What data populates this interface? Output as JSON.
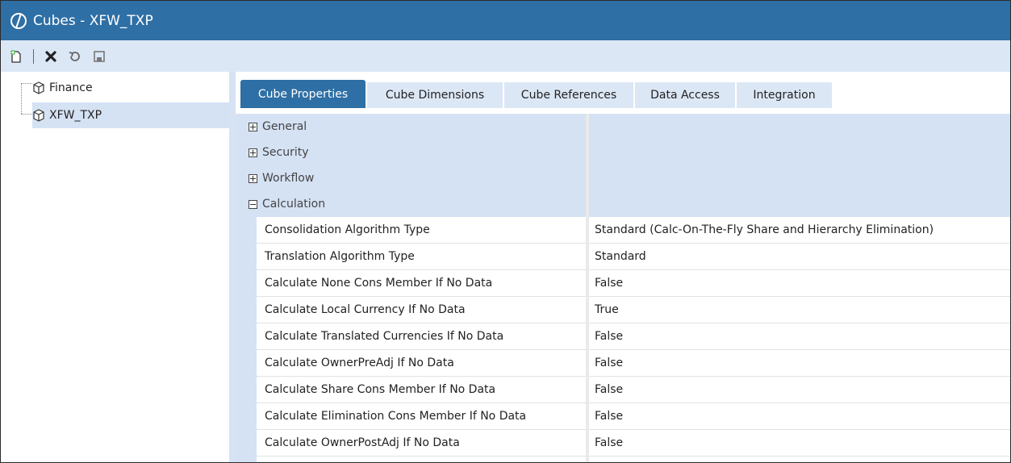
{
  "window": {
    "title": "Cubes - XFW_TXP"
  },
  "toolbar": {
    "buttons": [
      {
        "name": "new-icon"
      },
      {
        "name": "delete-icon"
      },
      {
        "name": "refresh-icon"
      },
      {
        "name": "save-icon"
      }
    ]
  },
  "tree": {
    "items": [
      {
        "label": "Finance",
        "icon": "cube-icon",
        "selected": false
      },
      {
        "label": "XFW_TXP",
        "icon": "cube-icon",
        "selected": true
      }
    ]
  },
  "tabs": [
    {
      "label": "Cube Properties",
      "active": true
    },
    {
      "label": "Cube Dimensions",
      "active": false
    },
    {
      "label": "Cube References",
      "active": false
    },
    {
      "label": "Data Access",
      "active": false
    },
    {
      "label": "Integration",
      "active": false
    }
  ],
  "categories": [
    {
      "label": "General",
      "expanded": false
    },
    {
      "label": "Security",
      "expanded": false
    },
    {
      "label": "Workflow",
      "expanded": false
    },
    {
      "label": "Calculation",
      "expanded": true
    }
  ],
  "properties": [
    {
      "name": "Consolidation Algorithm Type",
      "value": "Standard (Calc-On-The-Fly Share and Hierarchy Elimination)"
    },
    {
      "name": "Translation Algorithm Type",
      "value": "Standard"
    },
    {
      "name": "Calculate None Cons Member If No Data",
      "value": "False"
    },
    {
      "name": "Calculate Local Currency If No Data",
      "value": "True"
    },
    {
      "name": "Calculate Translated Currencies If No Data",
      "value": "False"
    },
    {
      "name": "Calculate OwnerPreAdj If No Data",
      "value": "False"
    },
    {
      "name": "Calculate Share Cons Member If No Data",
      "value": "False"
    },
    {
      "name": "Calculate Elimination Cons Member If No Data",
      "value": "False"
    },
    {
      "name": "Calculate OwnerPostAdj If No Data",
      "value": "False"
    }
  ],
  "colors": {
    "accent": "#2e6fa5",
    "toolbar": "#dce7f6",
    "selection": "#d5e2f4"
  }
}
